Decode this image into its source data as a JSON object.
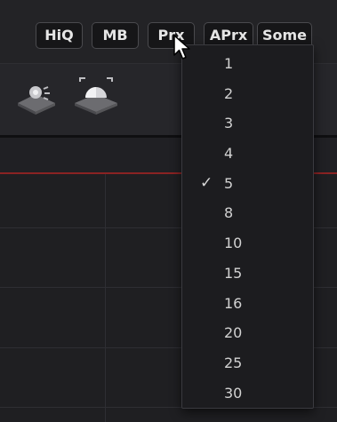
{
  "toolbar": {
    "buttons": [
      "HiQ",
      "MB",
      "Prx",
      "APrx",
      "Some"
    ]
  },
  "tools": [
    {
      "icon": "light-tool-icon"
    },
    {
      "icon": "camera-tool-icon"
    }
  ],
  "proxy_menu": {
    "options": [
      "1",
      "2",
      "3",
      "4",
      "5",
      "8",
      "10",
      "15",
      "16",
      "20",
      "25",
      "30"
    ],
    "selected": "5",
    "check_glyph": "✓"
  },
  "colors": {
    "background": "#1e1e21",
    "playhead": "#8a2323",
    "button_border": "#4a4a4e"
  }
}
